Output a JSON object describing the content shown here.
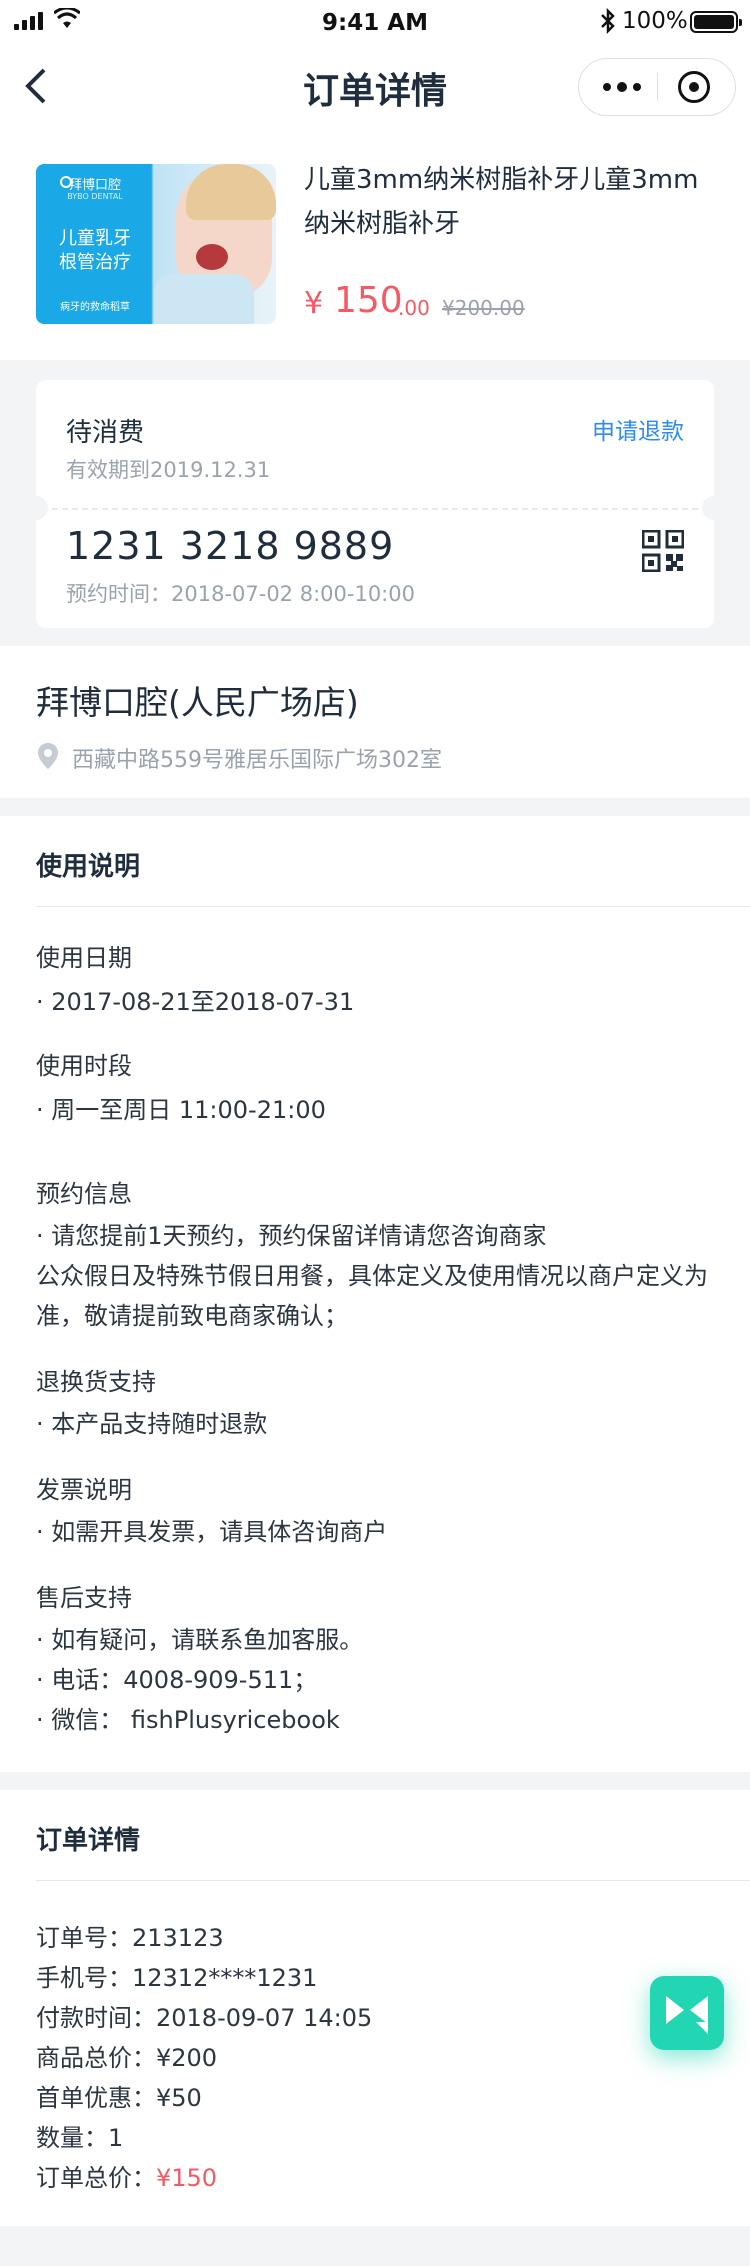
{
  "status_bar": {
    "time": "9:41 AM",
    "battery": "100%"
  },
  "nav": {
    "title": "订单详情"
  },
  "product": {
    "thumbnail": {
      "brand": "拜博口腔",
      "brand_sub": "BYBO DENTAL",
      "line1": "儿童乳牙",
      "line2": "根管治疗",
      "slogan": "病牙的救命稻草"
    },
    "name": "儿童3mm纳米树脂补牙儿童3mm纳米树脂补牙",
    "price_symbol": "¥",
    "price_integer": "150",
    "price_decimal": ".00",
    "original_price": "¥200.00"
  },
  "voucher": {
    "status": "待消费",
    "refund_label": "申请退款",
    "valid_until": "有效期到2019.12.31",
    "code": "1231 3218 9889",
    "appointment": "预约时间：2018-07-02 8:00-10:00"
  },
  "store": {
    "name": "拜博口腔(人民广场店)",
    "address": "西藏中路559号雅居乐国际广场302室"
  },
  "usage": {
    "title": "使用说明",
    "date_label": "使用日期",
    "date_value": "· 2017-08-21至2018-07-31",
    "period_label": "使用时段",
    "period_value": "· 周一至周日 11:00-21:00",
    "booking_label": "预约信息",
    "booking_value1": "· 请您提前1天预约，预约保留详情请您咨询商家",
    "booking_value2": "公众假日及特殊节假日用餐，具体定义及使用情况以商户定义为准，敬请提前致电商家确认；",
    "return_label": "退换货支持",
    "return_value": "· 本产品支持随时退款",
    "invoice_label": "发票说明",
    "invoice_value": "· 如需开具发票，请具体咨询商户",
    "aftersale_label": "售后支持",
    "aftersale_value1": "· 如有疑问，请联系鱼加客服。",
    "aftersale_value2": "· 电话：4008-909-511；",
    "aftersale_value3": "· 微信： fishPlusyricebook"
  },
  "order": {
    "title": "订单详情",
    "order_no": "订单号：213123",
    "phone": "手机号：12312****1231",
    "pay_time": "付款时间：2018-09-07 14:05",
    "goods_total": "商品总价：¥200",
    "first_discount": "首单优惠：¥50",
    "quantity": "数量：1",
    "total_label": "订单总价：",
    "total_value": "¥150"
  },
  "colors": {
    "accent_red": "#f55a64",
    "link_blue": "#2d8cf0",
    "fab_green": "#22d6b4"
  }
}
